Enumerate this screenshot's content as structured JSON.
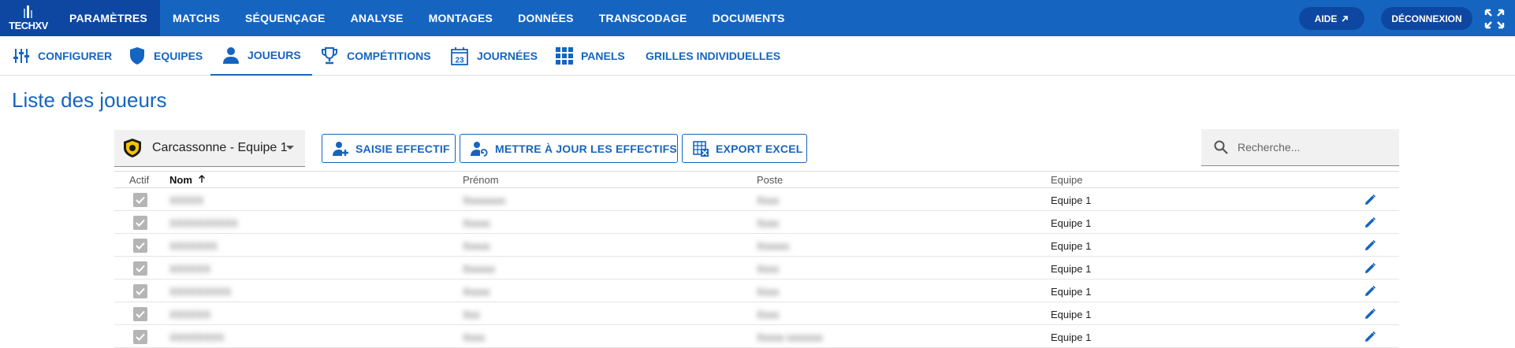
{
  "brand": {
    "logo_text": "TECHXV"
  },
  "topnav": [
    {
      "label": "PARAMÈTRES",
      "active": true
    },
    {
      "label": "MATCHS"
    },
    {
      "label": "SÉQUENÇAGE"
    },
    {
      "label": "ANALYSE"
    },
    {
      "label": "MONTAGES"
    },
    {
      "label": "DONNÉES"
    },
    {
      "label": "TRANSCODAGE"
    },
    {
      "label": "DOCUMENTS"
    }
  ],
  "header_actions": {
    "help_label": "AIDE",
    "logout_label": "DÉCONNEXION"
  },
  "subnav": [
    {
      "label": "CONFIGURER",
      "icon": "sliders-icon"
    },
    {
      "label": "EQUIPES",
      "icon": "shield-icon"
    },
    {
      "label": "JOUEURS",
      "icon": "person-icon",
      "active": true
    },
    {
      "label": "COMPÉTITIONS",
      "icon": "trophy-icon"
    },
    {
      "label": "JOURNÉES",
      "icon": "calendar-icon",
      "calendar_day": "23"
    },
    {
      "label": "PANELS",
      "icon": "grid-icon"
    },
    {
      "label": "GRILLES INDIVIDUELLES",
      "icon": ""
    }
  ],
  "page": {
    "title": "Liste des joueurs"
  },
  "toolbar": {
    "team_select": "Carcassonne - Equipe 1",
    "saisie_label": "SAISIE EFFECTIF",
    "maj_label": "METTRE À JOUR LES EFFECTIFS",
    "export_label": "EXPORT EXCEL",
    "search_placeholder": "Recherche..."
  },
  "table": {
    "headers": {
      "actif": "Actif",
      "nom": "Nom",
      "prenom": "Prénom",
      "poste": "Poste",
      "equipe": "Equipe"
    },
    "sort": {
      "column": "nom",
      "direction": "asc"
    },
    "rows": [
      {
        "actif": true,
        "nom": "XXXXX",
        "prenom": "Xxxxxxxx",
        "poste": "Xxxx",
        "equipe": "Equipe 1"
      },
      {
        "actif": true,
        "nom": "XXXXXXXXXX",
        "prenom": "Xxxxx",
        "poste": "Xxxx",
        "equipe": "Equipe 1"
      },
      {
        "actif": true,
        "nom": "XXXXXXX",
        "prenom": "Xxxxx",
        "poste": "Xxxxxx",
        "equipe": "Equipe 1"
      },
      {
        "actif": true,
        "nom": "XXXXXX",
        "prenom": "Xxxxxx",
        "poste": "Xxxx",
        "equipe": "Equipe 1"
      },
      {
        "actif": true,
        "nom": "XXXXXXXXX",
        "prenom": "Xxxxx",
        "poste": "Xxxx",
        "equipe": "Equipe 1"
      },
      {
        "actif": true,
        "nom": "XXXXXX",
        "prenom": "Xxx",
        "poste": "Xxxx",
        "equipe": "Equipe 1"
      },
      {
        "actif": true,
        "nom": "XXXXXXXX",
        "prenom": "Xxxx",
        "poste": "Xxxxx xxxxxxx",
        "equipe": "Equipe 1"
      }
    ]
  },
  "colors": {
    "primary": "#1565c0",
    "primary_dark": "#0d47a1",
    "checkbox": "#b5b5b5"
  }
}
